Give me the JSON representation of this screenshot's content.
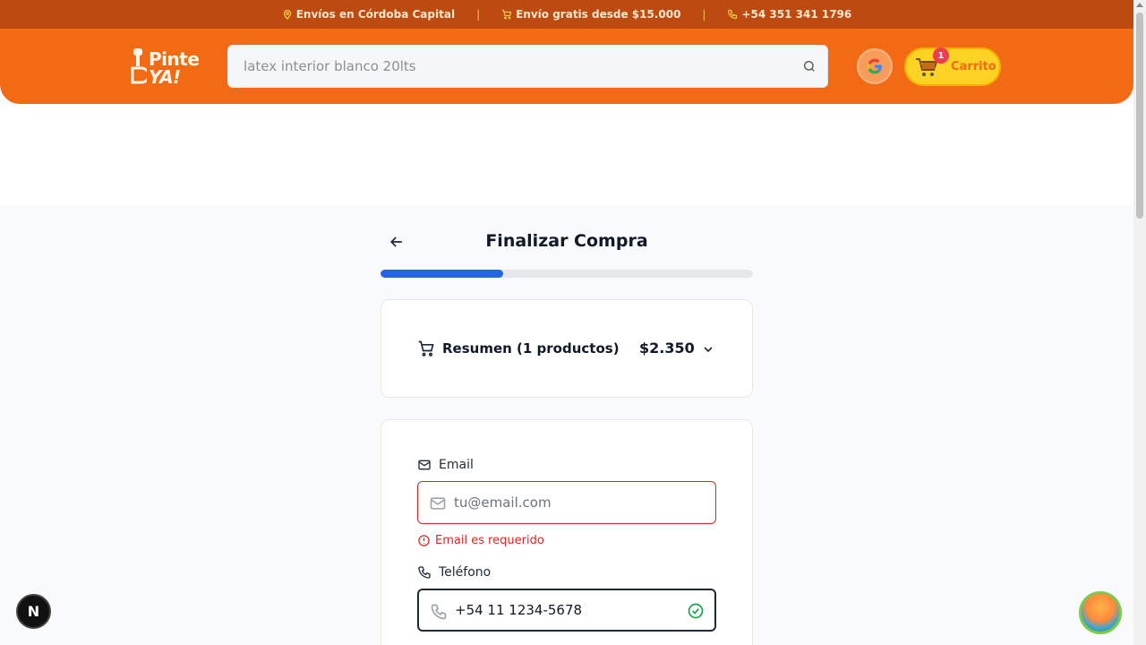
{
  "topbar": {
    "delivery": "Envíos en Córdoba Capital",
    "free_shipping": "Envío gratis desde $15.000",
    "phone": "+54 351 341 1796",
    "separator": "|"
  },
  "header": {
    "logo_line1": "Pinte",
    "logo_line2": "YA!",
    "search_placeholder": "latex interior blanco 20lts",
    "cart_label": "Carrito",
    "cart_count": "1"
  },
  "checkout": {
    "title": "Finalizar Compra",
    "progress_fraction": 0.33,
    "summary_label": "Resumen (1 productos)",
    "summary_total": "$2.350",
    "email_label": "Email",
    "email_placeholder": "tu@email.com",
    "email_error": "Email es requerido",
    "phone_label": "Teléfono",
    "phone_value": "+54 11 1234-5678"
  },
  "misc": {
    "next_badge": "N"
  },
  "colors": {
    "topbar": "#bd4a10",
    "header": "#f26a14",
    "cart_button": "#fcd224",
    "progress": "#2563eb",
    "error": "#dc2626",
    "success": "#16a34a"
  }
}
